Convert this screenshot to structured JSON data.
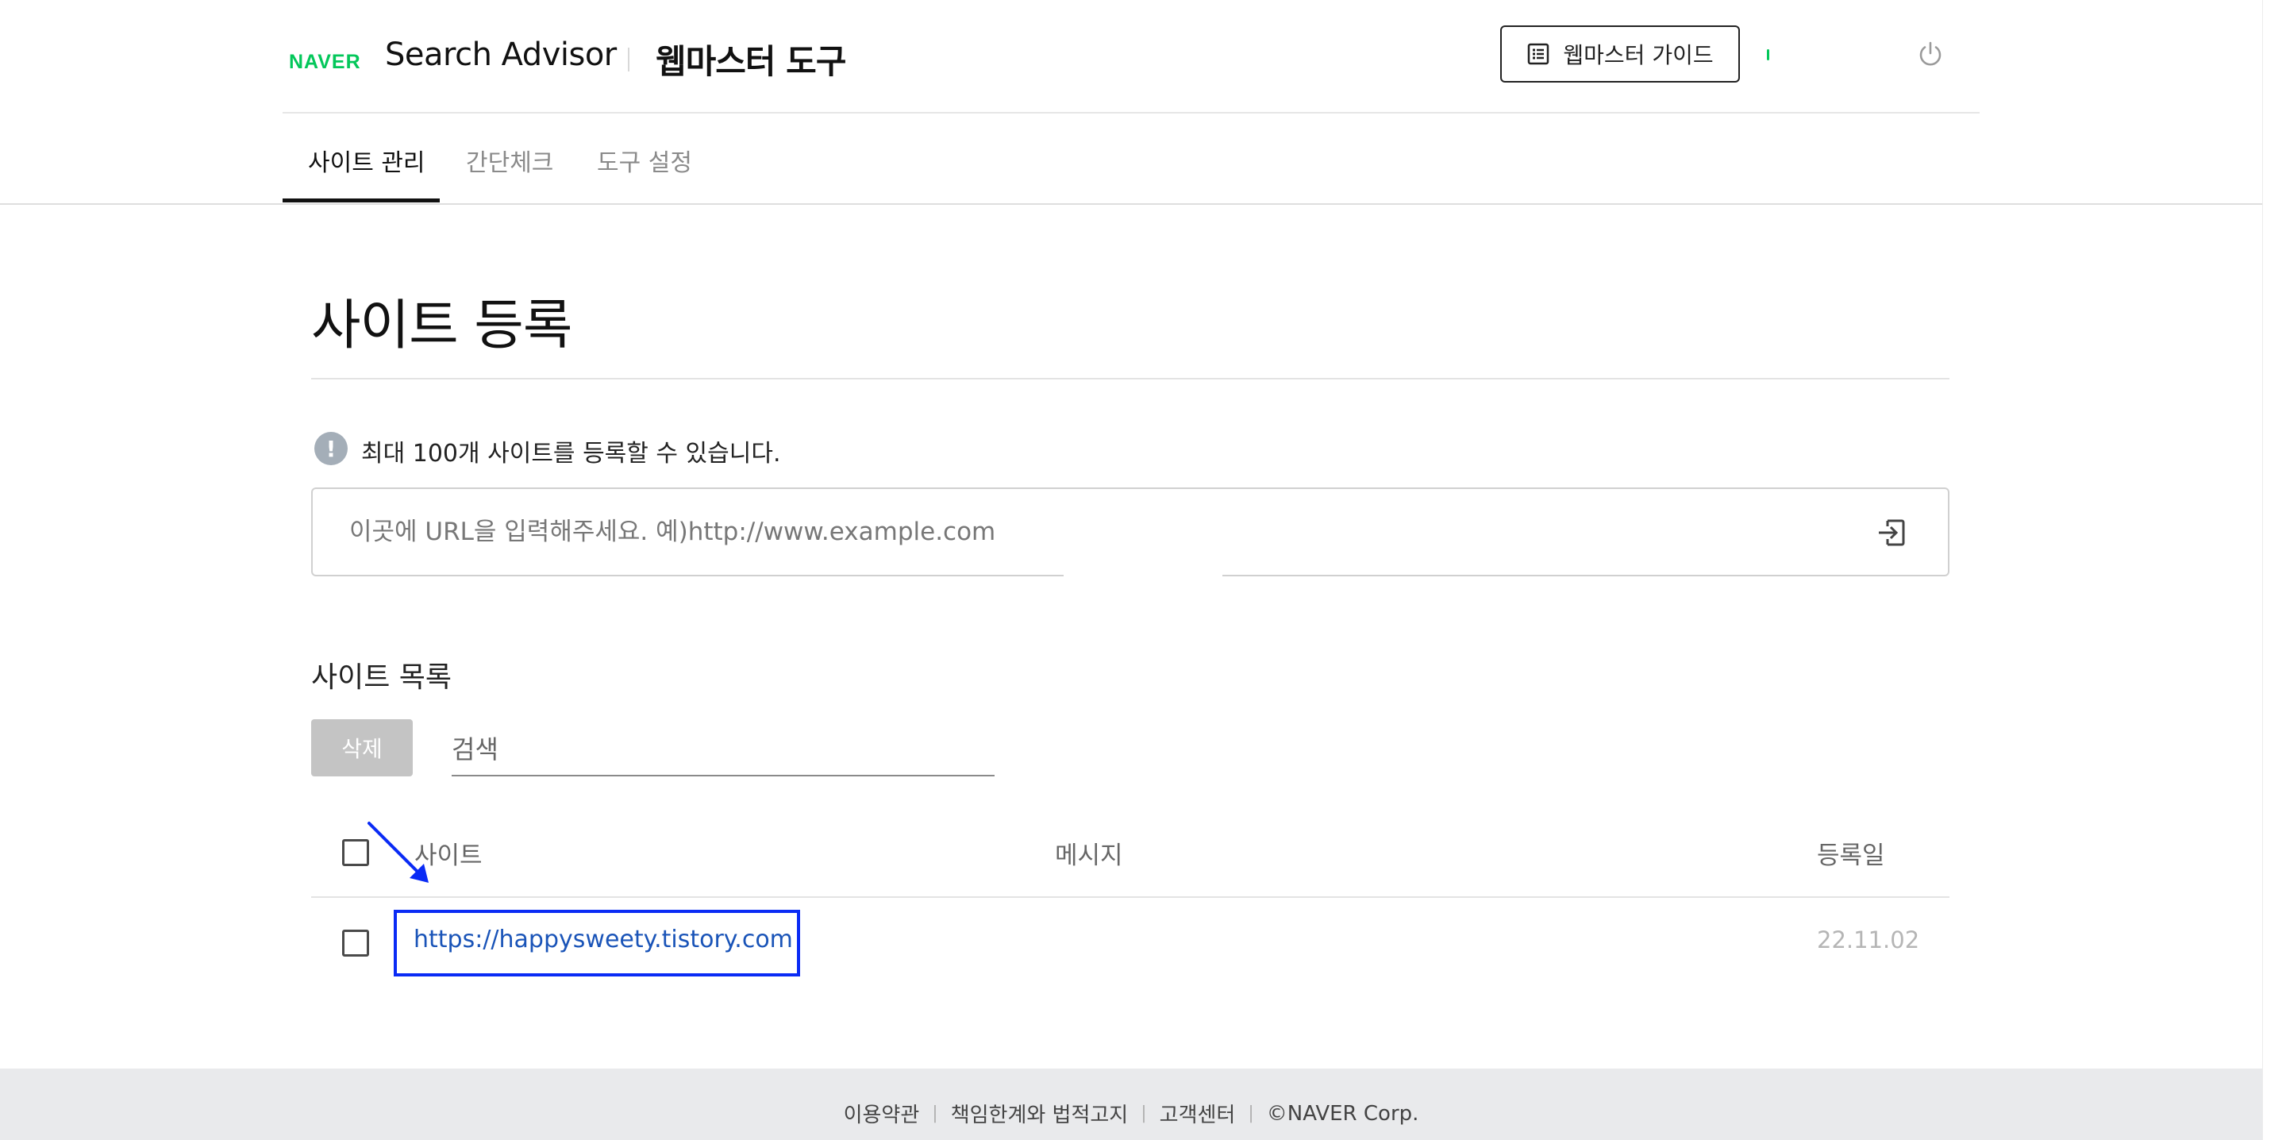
{
  "header": {
    "logo": "NAVER",
    "brand": "Search Advisor",
    "tool_title": "웹마스터 도구",
    "guide_button": "웹마스터 가이드"
  },
  "tabs": [
    {
      "label": "사이트 관리",
      "active": true
    },
    {
      "label": "간단체크",
      "active": false
    },
    {
      "label": "도구 설정",
      "active": false
    }
  ],
  "main": {
    "title": "사이트 등록",
    "notice": "최대 100개 사이트를 등록할 수 있습니다.",
    "url_placeholder": "이곳에 URL을 입력해주세요. 예)http://www.example.com",
    "list_title": "사이트 목록",
    "delete_button": "삭제",
    "search_placeholder": "검색"
  },
  "table": {
    "columns": [
      "사이트",
      "메시지",
      "등록일"
    ],
    "rows": [
      {
        "site": "https://happysweety.tistory.com",
        "message": "",
        "date": "22.11.02"
      }
    ]
  },
  "footer": {
    "links": [
      "이용약관",
      "책임한계와 법적고지",
      "고객센터",
      "©NAVER Corp."
    ]
  },
  "colors": {
    "naver_green": "#03c75a",
    "link_blue": "#1a54b8",
    "annotation_blue": "#0a2bf5",
    "footer_bg": "#e9eaec"
  }
}
